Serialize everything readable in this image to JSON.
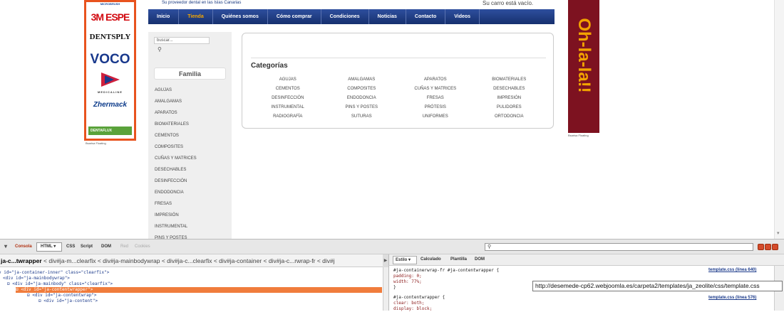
{
  "site": {
    "tagline": "Su proveedor dental en las Islas Canarias",
    "cart": "Su carro está vacío."
  },
  "left_banner": {
    "brands": [
      "MICROBRUSH",
      "3M ESPE",
      "DENTSPLY",
      "VOCO",
      "MEDICALINE",
      "Zhermack",
      "DENTAFLUX"
    ],
    "caption": "Bsarisa Floating"
  },
  "nav": {
    "items": [
      "Inicio",
      "Tienda",
      "Quiénes somos",
      "Cómo comprar",
      "Condiciones",
      "Noticias",
      "Contacto",
      "Videos"
    ]
  },
  "sidebar": {
    "search_value": "buscar...",
    "family_title": "Familia",
    "items": [
      "AGUJAS",
      "AMALGAMAS",
      "APARATOS",
      "BIOMATERIALES",
      "CEMENTOS",
      "COMPOSITES",
      "CUÑAS Y MATRICES",
      "DESECHABLES",
      "DESINFECCIÓN",
      "ENDODONCIA",
      "FRESAS",
      "IMPRESIÓN",
      "INSTRUMENTAL",
      "PINS Y POSTES"
    ]
  },
  "categories": {
    "title": "Categorías",
    "items": [
      "AGUJAS",
      "AMALGAMAS",
      "APARATOS",
      "BIOMATERIALES",
      "CEMENTOS",
      "COMPOSITES",
      "CUÑAS Y MATRICES",
      "DESECHABLES",
      "DESINFECCIÓN",
      "ENDODONCIA",
      "FRESAS",
      "IMPRESIÓN",
      "INSTRUMENTAL",
      "PINS Y POSTES",
      "PRÓTESIS",
      "PULIDORES",
      "RADIOGRAFÍA",
      "SUTURAS",
      "UNIFORMES",
      "ORTODONCIA"
    ]
  },
  "right_banner": {
    "text": "Oh-la-la!!",
    "caption": "Bsarisa Floating"
  },
  "firebug": {
    "tabs": [
      "Consola",
      "HTML ▾",
      "CSS",
      "Script",
      "DOM",
      "Red",
      "Cookies"
    ],
    "breadcrumb_last": "ja-c...twrapper",
    "breadcrumb_rest": "< div#ja-m...clearfix < div#ja-mainbodywrap < div#ja-c...clearfix < div#ja-container < div#ja-c...rwrap-fr < div#j",
    "html_lines": [
      "v id=\"ja-container-inner\" class=\"clearfix\">",
      "<div id=\"ja-mainbodywrap\">",
      "⊟ <div id=\"ja-mainbody\" class=\"clearfix\">",
      "⊟ <div id=\"ja-contentwrapper\">",
      "⊟ <div id=\"ja-contentwrap\">",
      "⊟ <div id=\"ja-content\">"
    ],
    "side_tabs": [
      "Estilo ▾",
      "Calculado",
      "Plantilla",
      "DOM"
    ],
    "css_lines": [
      "#ja-containerwrap-fr #ja-contentwrapper {",
      "    padding: 0;",
      "    width: 77%;",
      "}",
      "#ja-contentwrapper {",
      "    clear: both;",
      "    display: block;"
    ],
    "css_links": [
      "template.css (línea 640)",
      "template.css (línea 576)"
    ],
    "tooltip": "http://desemede-cp62.webjoomla.es/carpeta2/templates/ja_zeolite/css/template.css"
  },
  "colors": {
    "nav_bg": "#1f3a80",
    "nav_active": "#f7a800",
    "banner_orange": "#e8531e",
    "banner_maroon": "#7d1220",
    "selection": "#f07c3c"
  }
}
